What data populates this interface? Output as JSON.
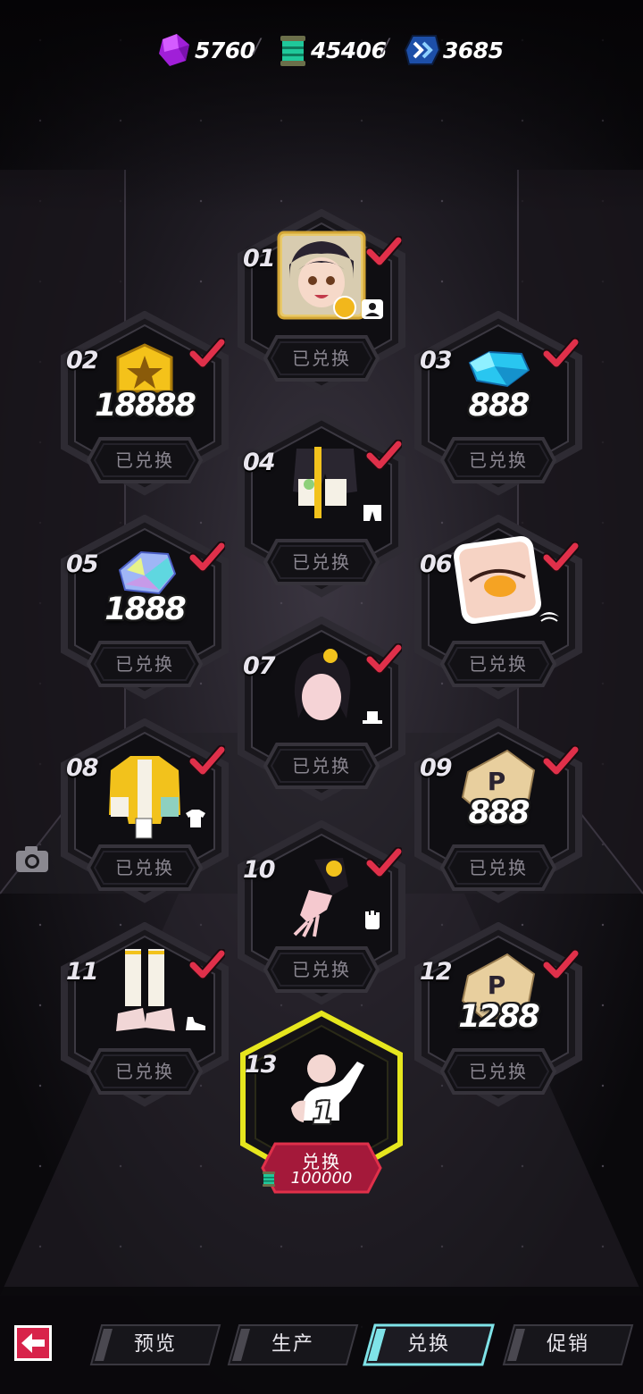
{
  "currencies": [
    {
      "icon": "purple-crystal-icon",
      "value": "5760"
    },
    {
      "icon": "green-ticket-icon",
      "value": "45406"
    },
    {
      "icon": "blue-chevron-coin-icon",
      "value": "3685"
    }
  ],
  "currency_separator": "/",
  "rewards": [
    {
      "num": "01",
      "item": "character-portrait-icon",
      "slot": "person-icon",
      "amount": "",
      "status": "已兑换"
    },
    {
      "num": "02",
      "item": "gold-badge-icon",
      "slot": "",
      "amount": "18888",
      "status": "已兑换"
    },
    {
      "num": "03",
      "item": "blue-gem-icon",
      "slot": "",
      "amount": "888",
      "status": "已兑换"
    },
    {
      "num": "04",
      "item": "shorts-outfit-icon",
      "slot": "pants-icon",
      "amount": "",
      "status": "已兑换"
    },
    {
      "num": "05",
      "item": "holo-crystal-icon",
      "slot": "",
      "amount": "1888",
      "status": "已兑换"
    },
    {
      "num": "06",
      "item": "eye-makeup-icon",
      "slot": "eye-icon",
      "amount": "",
      "status": "已兑换"
    },
    {
      "num": "07",
      "item": "hairstyle-icon",
      "slot": "hat-icon",
      "amount": "",
      "status": "已兑换"
    },
    {
      "num": "08",
      "item": "jacket-outfit-icon",
      "slot": "shirt-icon",
      "amount": "",
      "status": "已兑换"
    },
    {
      "num": "09",
      "item": "p-card-icon",
      "slot": "",
      "amount": "888",
      "status": "已兑换"
    },
    {
      "num": "10",
      "item": "glove-icon",
      "slot": "glove-slot-icon",
      "amount": "",
      "status": "已兑换"
    },
    {
      "num": "11",
      "item": "leg-warmers-sneakers-icon",
      "slot": "shoe-icon",
      "amount": "",
      "status": "已兑换"
    },
    {
      "num": "12",
      "item": "p-card-icon",
      "slot": "",
      "amount": "1288",
      "status": "已兑换"
    }
  ],
  "special": {
    "num": "13",
    "item": "pose-action-icon",
    "badge": "1",
    "button_label": "兑换",
    "cost": "100000",
    "cost_icon": "green-ticket-icon"
  },
  "side": {
    "camera_icon": "camera-icon"
  },
  "nav": {
    "back_icon": "back-arrow-icon",
    "tabs": [
      {
        "label": "预览",
        "active": false
      },
      {
        "label": "生产",
        "active": false
      },
      {
        "label": "兑换",
        "active": true
      },
      {
        "label": "促销",
        "active": false
      }
    ]
  },
  "colors": {
    "background": "#0b0a0d",
    "check": "#e0304a",
    "special_border": "#e6e61e",
    "redeem_button": "#a4193a",
    "active_tab_accent": "#7fe3e8",
    "back_button": "#d8234a"
  }
}
